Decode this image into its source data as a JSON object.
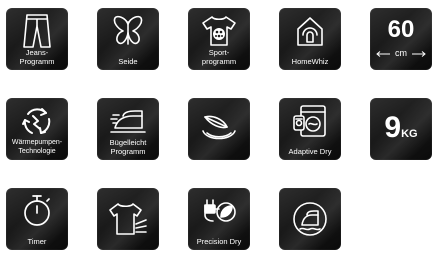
{
  "tiles": {
    "jeans": {
      "label": "Jeans-\nProgramm",
      "icon": "jeans-icon"
    },
    "seide": {
      "label": "Seide",
      "icon": "butterfly-icon"
    },
    "sport": {
      "label": "Sport-\nprogramm",
      "icon": "tshirt-ball-icon"
    },
    "homewhiz": {
      "label": "HomeWhiz",
      "icon": "smart-home-icon"
    },
    "temp": {
      "value": "60",
      "unit": "cm"
    },
    "waermepumpe": {
      "label": "Wärmepumpen-\nTechnologie",
      "icon": "heat-pump-cycle-icon"
    },
    "buegel": {
      "label": "Bügelleicht\nProgramm",
      "icon": "iron-icon"
    },
    "feather": {
      "icon": "feather-bowl-icon"
    },
    "adaptive": {
      "label": "Adaptive Dry",
      "icon": "dryer-sensor-icon"
    },
    "capacity": {
      "value": "9",
      "unit": "KG"
    },
    "timer": {
      "label": "Timer",
      "icon": "stopwatch-icon"
    },
    "shirt": {
      "icon": "shirt-air-icon"
    },
    "precision": {
      "label": "Precision Dry",
      "icon": "plug-leaf-icon"
    },
    "ironsafe": {
      "icon": "iron-circle-icon"
    }
  }
}
